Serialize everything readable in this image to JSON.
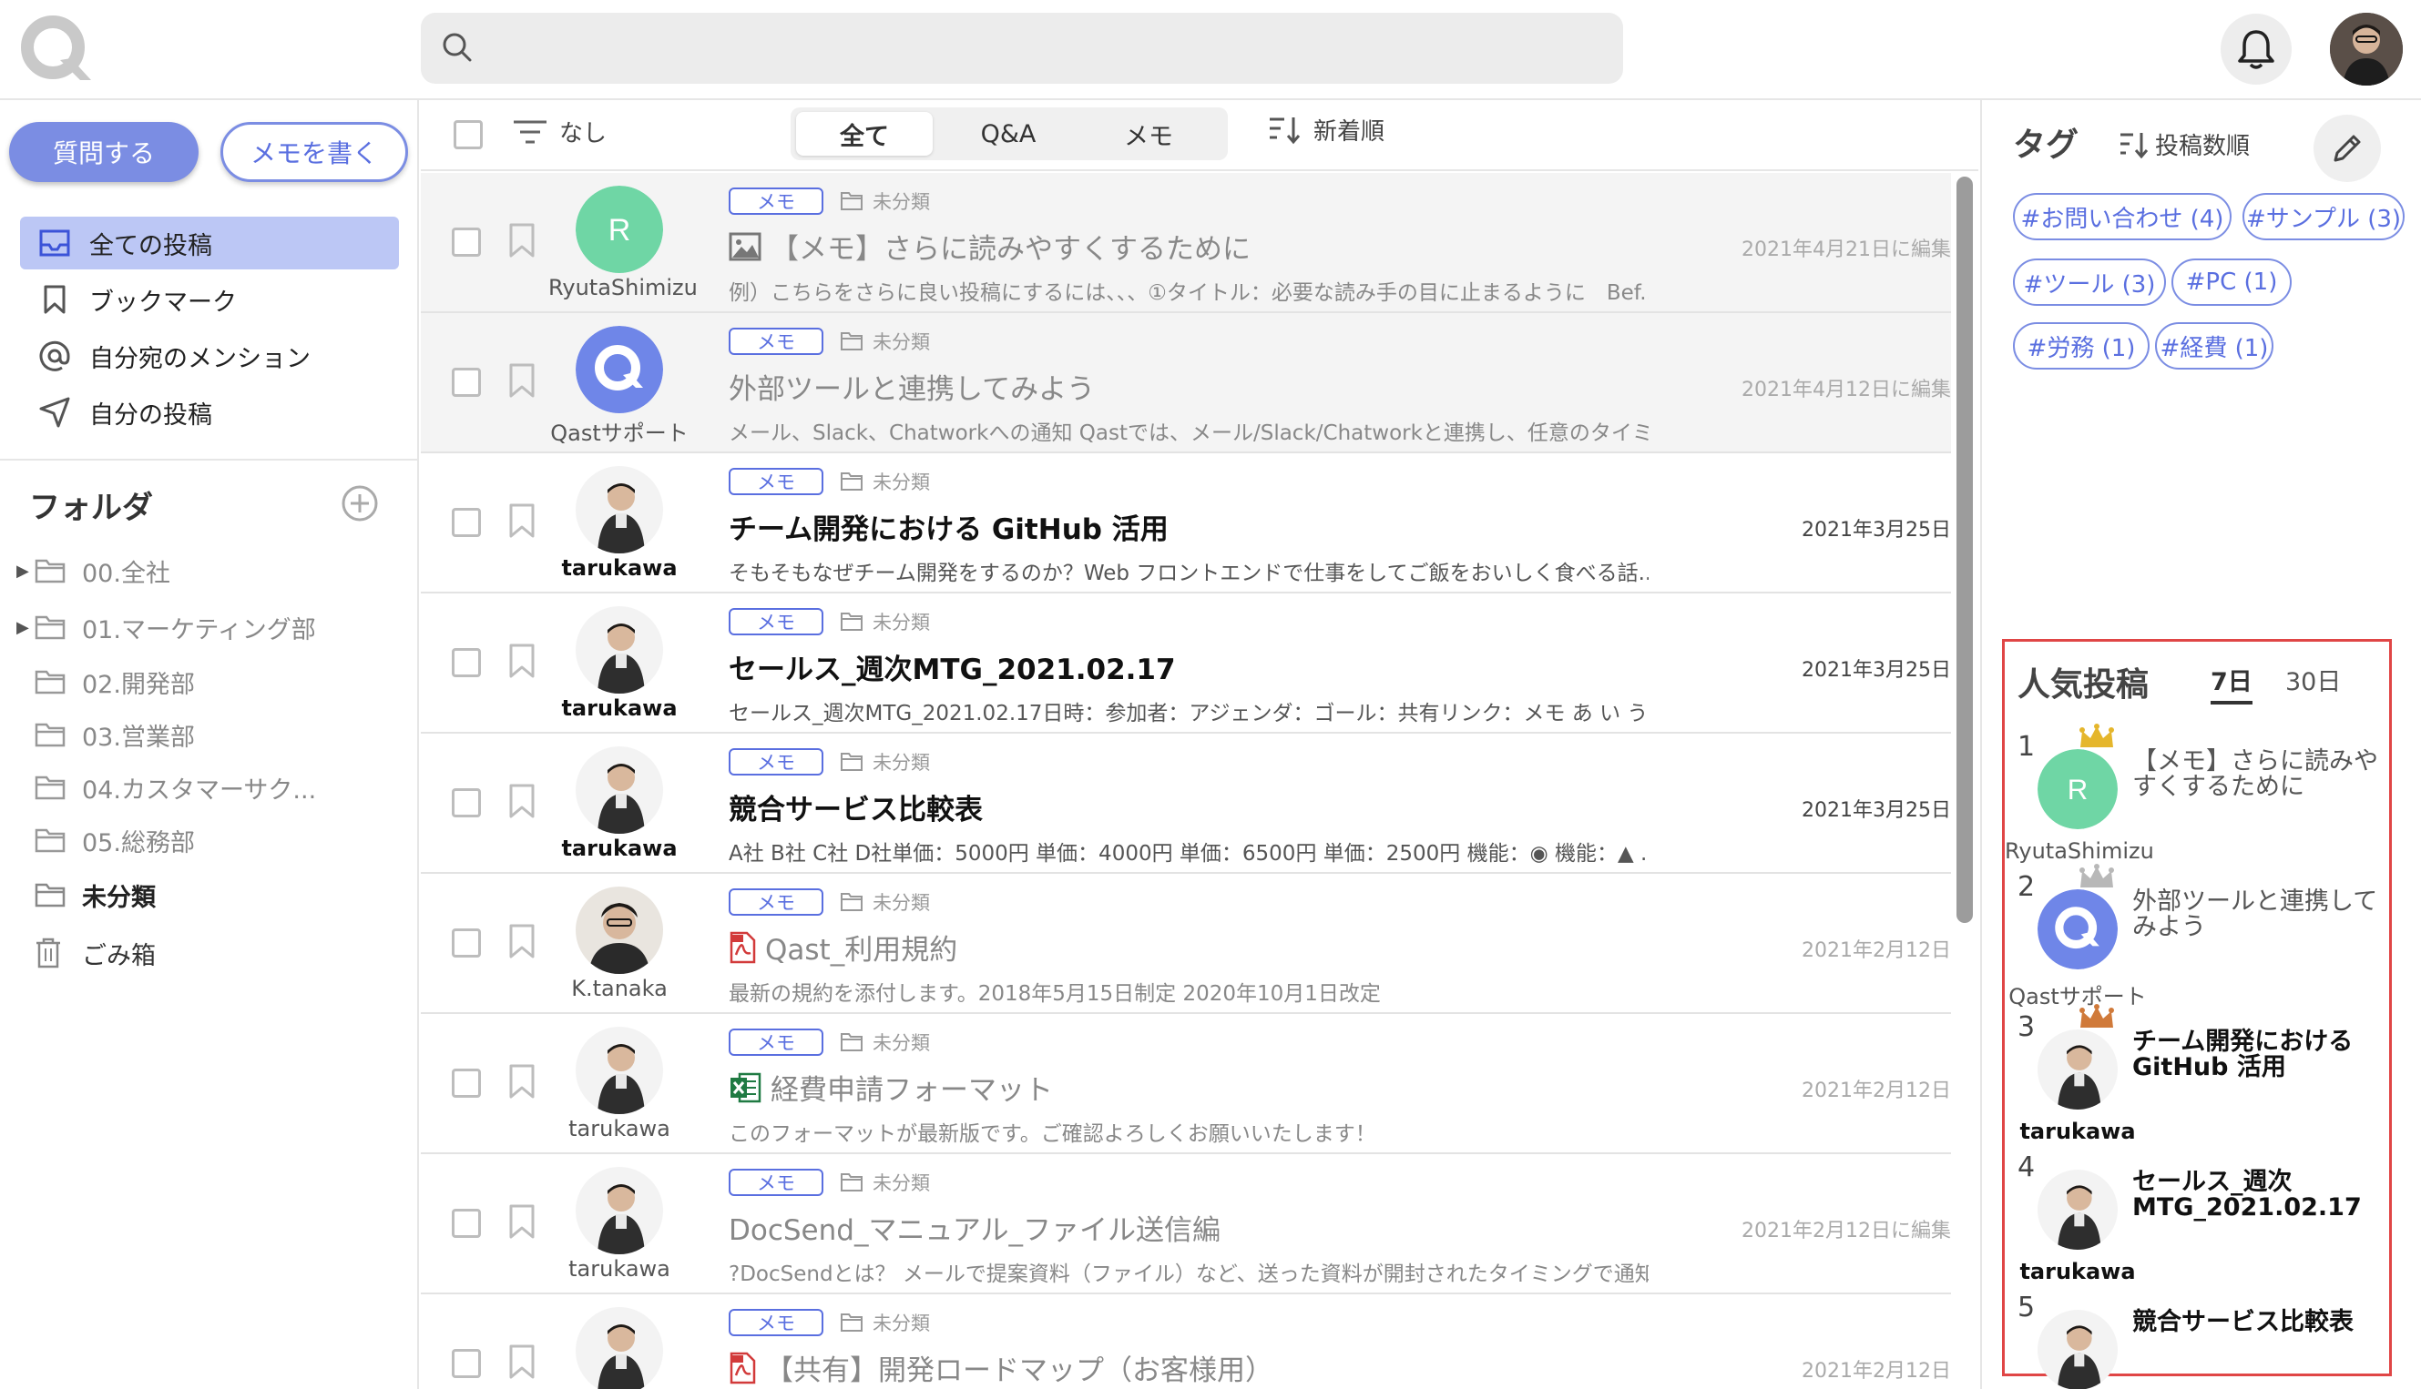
{
  "search": {
    "placeholder": ""
  },
  "sidebar": {
    "ask_label": "質問する",
    "memo_label": "メモを書く",
    "nav": [
      {
        "label": "全ての投稿",
        "icon": "inbox-icon",
        "active": true
      },
      {
        "label": "ブックマーク",
        "icon": "bookmark-icon",
        "active": false
      },
      {
        "label": "自分宛のメンション",
        "icon": "at-icon",
        "active": false
      },
      {
        "label": "自分の投稿",
        "icon": "send-icon",
        "active": false
      }
    ],
    "folders_title": "フォルダ",
    "folders": [
      {
        "label": "00.全社",
        "expandable": true
      },
      {
        "label": "01.マーケティング部",
        "expandable": true
      },
      {
        "label": "02.開発部",
        "expandable": false
      },
      {
        "label": "03.営業部",
        "expandable": false
      },
      {
        "label": "04.カスタマーサク...",
        "expandable": false
      },
      {
        "label": "05.総務部",
        "expandable": false
      },
      {
        "label": "未分類",
        "expandable": false,
        "bold": true
      },
      {
        "label": "ごみ箱",
        "expandable": false,
        "icon": "trash-icon"
      }
    ]
  },
  "toolbar": {
    "filter_label": "なし",
    "tabs": [
      "全て",
      "Q&A",
      "メモ"
    ],
    "active_tab": "全て",
    "sort_label": "新着順"
  },
  "posts": [
    {
      "badge": "メモ",
      "category": "未分類",
      "title": "【メモ】さらに読みやすくするために",
      "title_icon": "image-icon",
      "excerpt": "例）こちらをさらに良い投稿にするには、、、①タイトル：必要な読み手の目に止まるように　Bef...",
      "date": "2021年4月21日に編集",
      "author": "RyutaShimizu",
      "avatar": "initial-R",
      "read": true
    },
    {
      "badge": "メモ",
      "category": "未分類",
      "title": "外部ツールと連携してみよう",
      "title_icon": "",
      "excerpt": "メール、Slack、Chatworkへの通知 Qastでは、メール/Slack/Chatworkと連携し、任意のタイミン...",
      "date": "2021年4月12日に編集",
      "author": "Qastサポート",
      "avatar": "qast-logo",
      "read": true
    },
    {
      "badge": "メモ",
      "category": "未分類",
      "title": "チーム開発における GitHub 活用",
      "title_icon": "",
      "excerpt": "そもそもなぜチーム開発をするのか？Web フロントエンドで仕事をしてご飯をおいしく食べる話...",
      "date": "2021年3月25日",
      "author": "tarukawa",
      "avatar": "photo-tarukawa",
      "read": false
    },
    {
      "badge": "メモ",
      "category": "未分類",
      "title": "セールス_週次MTG_2021.02.17",
      "title_icon": "",
      "excerpt": "セールス_週次MTG_2021.02.17日時：参加者：アジェンダ：ゴール：共有リンク：メモ あ い う ...",
      "date": "2021年3月25日",
      "author": "tarukawa",
      "avatar": "photo-tarukawa",
      "read": false
    },
    {
      "badge": "メモ",
      "category": "未分類",
      "title": "競合サービス比較表",
      "title_icon": "",
      "excerpt": "A社 B社 C社 D社単価：5000円 単価：4000円 単価：6500円 単価：2500円 機能：◉ 機能：▲ ...",
      "date": "2021年3月25日",
      "author": "tarukawa",
      "avatar": "photo-tarukawa",
      "read": false
    },
    {
      "badge": "メモ",
      "category": "未分類",
      "title": "Qast_利用規約",
      "title_icon": "pdf-icon",
      "excerpt": "最新の規約を添付します。2018年5月15日制定 2020年10月1日改定",
      "date": "2021年2月12日",
      "author": "K.tanaka",
      "avatar": "photo-ktanaka",
      "read": true
    },
    {
      "badge": "メモ",
      "category": "未分類",
      "title": "経費申請フォーマット",
      "title_icon": "excel-icon",
      "excerpt": "このフォーマットが最新版です。ご確認よろしくお願いいたします！",
      "date": "2021年2月12日",
      "author": "tarukawa",
      "avatar": "photo-tarukawa",
      "read": true
    },
    {
      "badge": "メモ",
      "category": "未分類",
      "title": "DocSend_マニュアル_ファイル送信編",
      "title_icon": "",
      "excerpt": "?DocSendとは？ メールで提案資料（ファイル）など、送った資料が開封されたタイミングで通知...",
      "date": "2021年2月12日に編集",
      "author": "tarukawa",
      "avatar": "photo-tarukawa",
      "read": true
    },
    {
      "badge": "メモ",
      "category": "未分類",
      "title": "【共有】開発ロードマップ（お客様用）",
      "title_icon": "pdf-icon",
      "excerpt": "",
      "date": "2021年2月12日",
      "author": "",
      "avatar": "photo-tarukawa",
      "read": true
    }
  ],
  "tags_panel": {
    "title": "タグ",
    "sort_label": "投稿数順",
    "tags": [
      "#お問い合わせ (4)",
      "#サンプル (3)",
      "#ツール (3)",
      "#PC (1)",
      "#労務 (1)",
      "#経費 (1)"
    ]
  },
  "popular": {
    "title": "人気投稿",
    "periods": [
      "7日",
      "30日"
    ],
    "active_period": "7日",
    "items": [
      {
        "rank": "1",
        "title": "【メモ】さらに読みやすくするために",
        "author": "RyutaShimizu",
        "avatar": "initial-R",
        "crown": "#e5b62c",
        "read": true
      },
      {
        "rank": "2",
        "title": "外部ツールと連携してみよう",
        "author": "Qastサポート",
        "avatar": "qast-logo",
        "crown": "#b8b8b8",
        "read": true
      },
      {
        "rank": "3",
        "title": "チーム開発における GitHub 活用",
        "author": "tarukawa",
        "avatar": "photo-tarukawa",
        "crown": "#d07a3a",
        "read": false
      },
      {
        "rank": "4",
        "title": "セールス_週次MTG_2021.02.17",
        "author": "tarukawa",
        "avatar": "photo-tarukawa",
        "crown": "",
        "read": false
      },
      {
        "rank": "5",
        "title": "競合サービス比較表",
        "author": "",
        "avatar": "photo-tarukawa",
        "crown": "",
        "read": false
      }
    ]
  },
  "colors": {
    "accent": "#7b8de3",
    "accent_text": "#5a6fe0",
    "highlight_border": "#e04646",
    "avatar_green": "#6fd6a5"
  }
}
